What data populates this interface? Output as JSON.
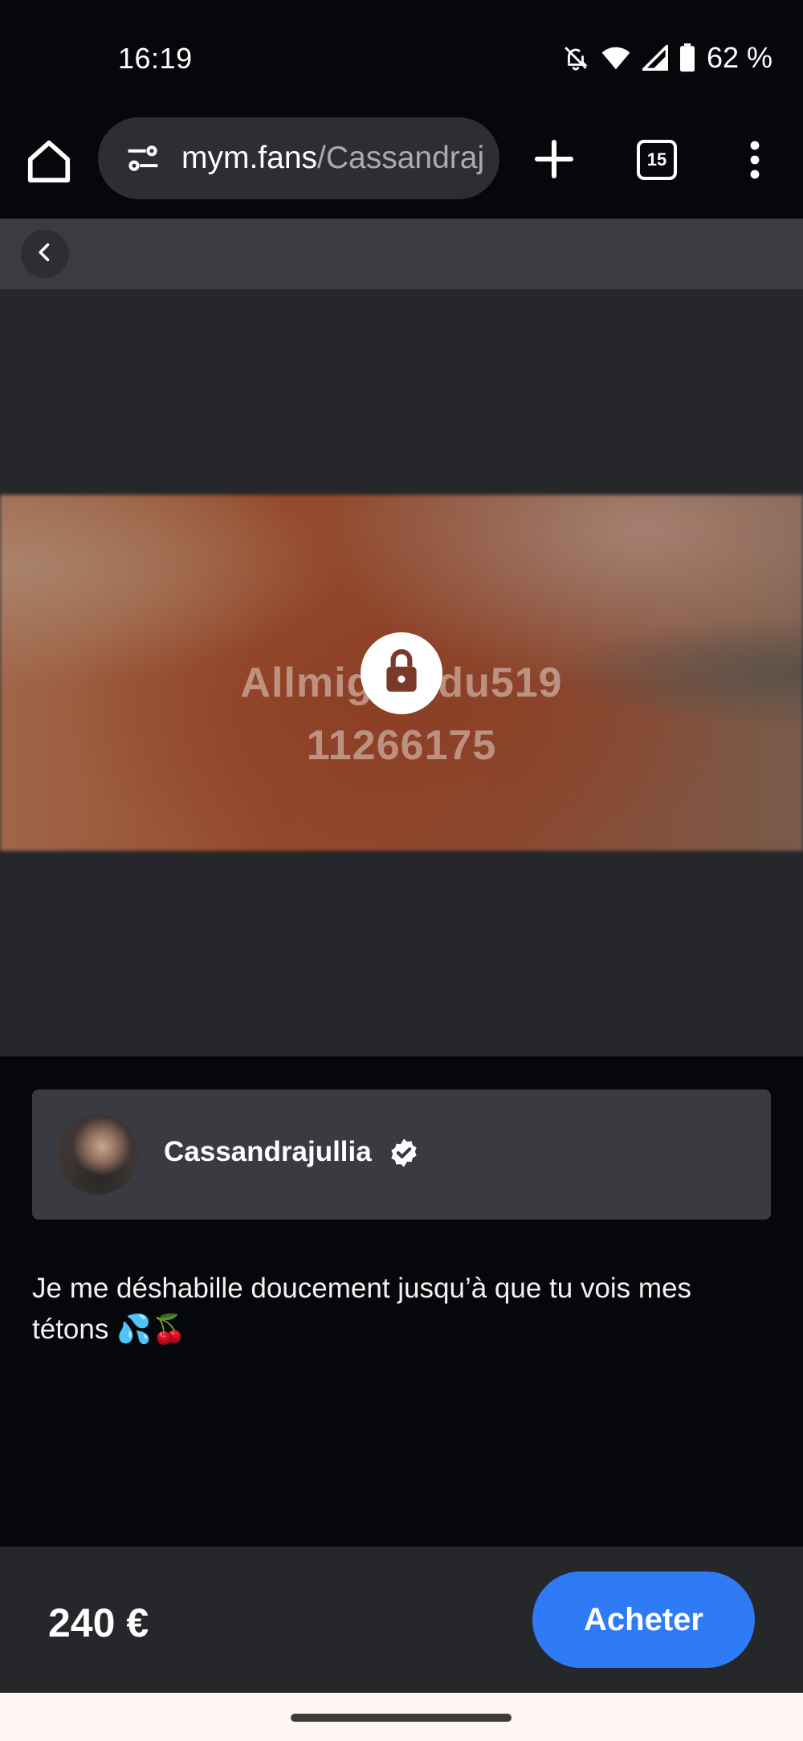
{
  "status_bar": {
    "time": "16:19",
    "battery": "62 %",
    "icons": [
      "bell-off-icon",
      "wifi-icon",
      "signal-icon",
      "battery-icon"
    ]
  },
  "browser": {
    "url_host": "mym.fans",
    "url_path": "/Cassandraj",
    "tab_count": "15",
    "icons": [
      "home-icon",
      "site-settings-icon",
      "new-tab-icon",
      "tab-switcher-icon",
      "more-menu-icon"
    ]
  },
  "media": {
    "watermark_line1": "Allmightydu519",
    "watermark_line2": "11266175",
    "locked": true
  },
  "creator": {
    "name": "Cassandrajullia",
    "verified": true
  },
  "description": "Je me déshabille doucement jusqu’à que tu vois mes tétons 💦🍒",
  "purchase": {
    "price": "240 €",
    "button_label": "Acheter",
    "button_color": "#2f7bf5"
  }
}
